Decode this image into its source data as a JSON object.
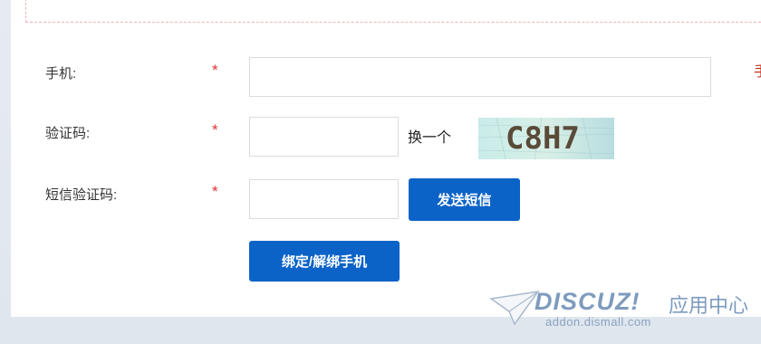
{
  "form": {
    "phone": {
      "label": "手机:",
      "required_mark": "*",
      "value": ""
    },
    "captcha": {
      "label": "验证码:",
      "required_mark": "*",
      "value": "",
      "refresh_label": "换一个",
      "image_text": "C8H7"
    },
    "sms_code": {
      "label": "短信验证码:",
      "required_mark": "*",
      "value": "",
      "send_label": "发送短信"
    },
    "submit_label": "绑定/解绑手机",
    "side_hint_fragment": "手"
  },
  "watermark": {
    "brand": "DISCUZ!",
    "brand_cn": "应用中心",
    "url": "addon.dismall.com"
  },
  "colors": {
    "primary_button": "#0b63c8",
    "required": "#e13232",
    "watermark": "#7e9bbf"
  }
}
